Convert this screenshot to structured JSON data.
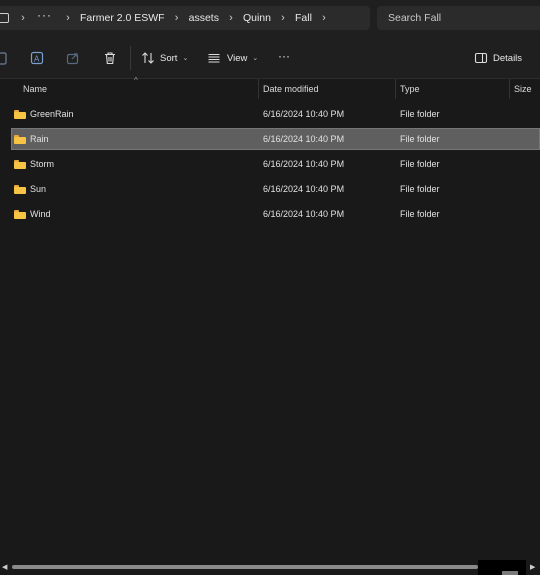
{
  "breadcrumb": {
    "more": "···",
    "items": [
      "Farmer 2.0 ESWF",
      "assets",
      "Quinn",
      "Fall"
    ]
  },
  "search": {
    "placeholder": "Search Fall"
  },
  "toolbar": {
    "sort_label": "Sort",
    "view_label": "View",
    "more_label": "···",
    "details_label": "Details"
  },
  "columns": {
    "name": "Name",
    "date": "Date modified",
    "type": "Type",
    "size": "Size"
  },
  "files": [
    {
      "name": "GreenRain",
      "date": "6/16/2024 10:40 PM",
      "type": "File folder",
      "icon": "folder-icon",
      "selected": false
    },
    {
      "name": "Rain",
      "date": "6/16/2024 10:40 PM",
      "type": "File folder",
      "icon": "folder-icon",
      "selected": true
    },
    {
      "name": "Storm",
      "date": "6/16/2024 10:40 PM",
      "type": "File folder",
      "icon": "folder-icon",
      "selected": false
    },
    {
      "name": "Sun",
      "date": "6/16/2024 10:40 PM",
      "type": "File folder",
      "icon": "folder-icon",
      "selected": false
    },
    {
      "name": "Wind",
      "date": "6/16/2024 10:40 PM",
      "type": "File folder",
      "icon": "folder-icon",
      "selected": false
    }
  ],
  "colors": {
    "background": "#191919",
    "selected_row": "#5f5f5f",
    "folder": "#f6c344"
  }
}
